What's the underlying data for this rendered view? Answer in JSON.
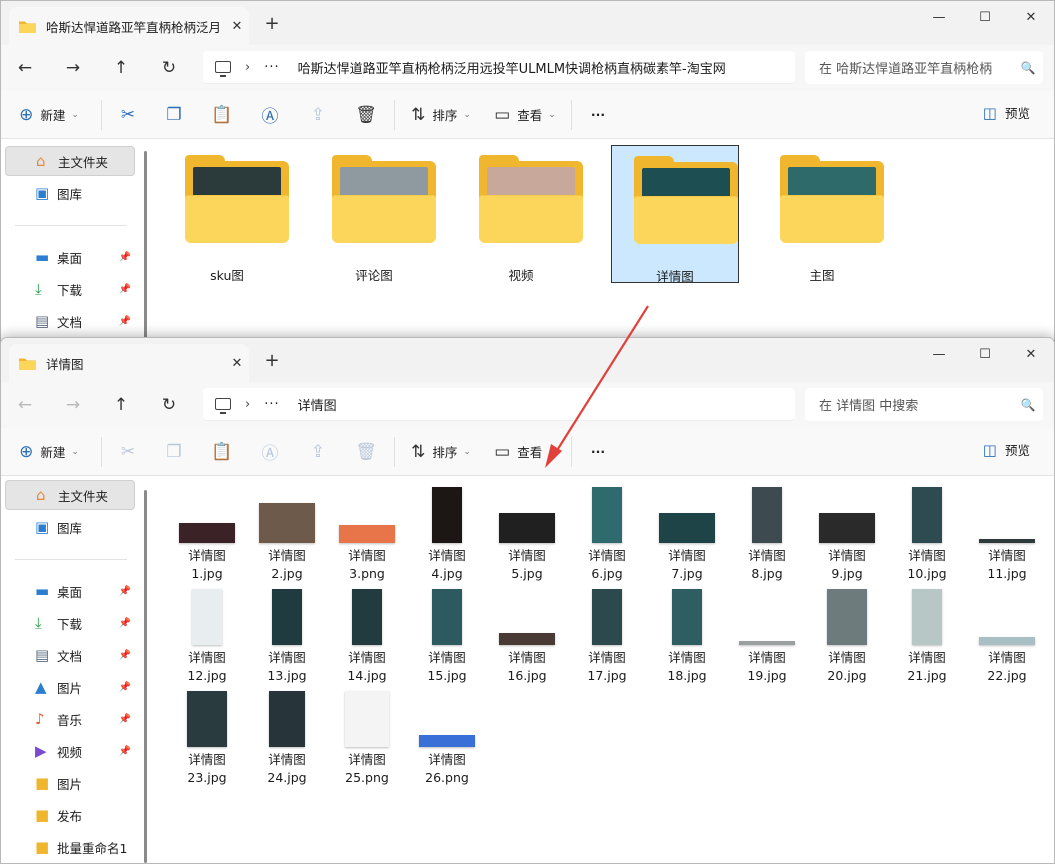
{
  "window_back": {
    "tab_title": "哈斯达悍道路亚竿直柄枪柄泛月",
    "address_path": "哈斯达悍道路亚竿直柄枪柄泛用远投竿ULMLM快调枪柄直柄碳素竿-淘宝网",
    "search_placeholder": "在 哈斯达悍道路亚竿直柄枪柄",
    "folders": [
      {
        "name": "sku图",
        "thumb_color": "#2b3a3a"
      },
      {
        "name": "评论图",
        "thumb_color": "#8e9aa0"
      },
      {
        "name": "视频",
        "thumb_color": "#c8a89a"
      },
      {
        "name": "详情图",
        "thumb_color": "#1d4f52"
      },
      {
        "name": "主图",
        "thumb_color": "#2e6a6a"
      }
    ],
    "sidebar": [
      {
        "label": "主文件夹",
        "icon": "home-icon"
      },
      {
        "label": "图库",
        "icon": "gallery-icon"
      },
      {
        "label": "桌面",
        "icon": "desktop-icon"
      },
      {
        "label": "下载",
        "icon": "download-icon"
      },
      {
        "label": "文档",
        "icon": "document-icon"
      }
    ]
  },
  "window_front": {
    "tab_title": "详情图",
    "address_path": "详情图",
    "search_placeholder": "在 详情图 中搜索",
    "sidebar": [
      {
        "label": "主文件夹",
        "icon": "home-icon"
      },
      {
        "label": "图库",
        "icon": "gallery-icon"
      },
      {
        "label": "桌面",
        "icon": "desktop-icon"
      },
      {
        "label": "下载",
        "icon": "download-icon"
      },
      {
        "label": "文档",
        "icon": "document-icon"
      },
      {
        "label": "图片",
        "icon": "pictures-icon"
      },
      {
        "label": "音乐",
        "icon": "music-icon"
      },
      {
        "label": "视频",
        "icon": "video-icon"
      },
      {
        "label": "图片",
        "icon": "folder-icon"
      },
      {
        "label": "发布",
        "icon": "folder-icon"
      },
      {
        "label": "批量重命名1",
        "icon": "folder-icon"
      }
    ],
    "files": [
      {
        "l1": "详情图",
        "l2": "1.jpg",
        "c": "#3a2226"
      },
      {
        "l1": "详情图",
        "l2": "2.jpg",
        "c": "#6d5a4a"
      },
      {
        "l1": "详情图",
        "l2": "3.png",
        "c": "#e8744a"
      },
      {
        "l1": "详情图",
        "l2": "4.jpg",
        "c": "#1c1714"
      },
      {
        "l1": "详情图",
        "l2": "5.jpg",
        "c": "#202020"
      },
      {
        "l1": "详情图",
        "l2": "6.jpg",
        "c": "#2f6a6e"
      },
      {
        "l1": "详情图",
        "l2": "7.jpg",
        "c": "#1e4448"
      },
      {
        "l1": "详情图",
        "l2": "8.jpg",
        "c": "#3d4b50"
      },
      {
        "l1": "详情图",
        "l2": "9.jpg",
        "c": "#2a2a2a"
      },
      {
        "l1": "详情图",
        "l2": "10.jpg",
        "c": "#2d4b50"
      },
      {
        "l1": "详情图",
        "l2": "11.jpg",
        "c": "#2f3a3a"
      },
      {
        "l1": "详情图",
        "l2": "12.jpg",
        "c": "#e8eef0"
      },
      {
        "l1": "详情图",
        "l2": "13.jpg",
        "c": "#1f3b40"
      },
      {
        "l1": "详情图",
        "l2": "14.jpg",
        "c": "#223b3f"
      },
      {
        "l1": "详情图",
        "l2": "15.jpg",
        "c": "#2d5a60"
      },
      {
        "l1": "详情图",
        "l2": "16.jpg",
        "c": "#4a3a36"
      },
      {
        "l1": "详情图",
        "l2": "17.jpg",
        "c": "#2c4a4e"
      },
      {
        "l1": "详情图",
        "l2": "18.jpg",
        "c": "#2f5e62"
      },
      {
        "l1": "详情图",
        "l2": "19.jpg",
        "c": "#9aa0a0"
      },
      {
        "l1": "详情图",
        "l2": "20.jpg",
        "c": "#6e7b7d"
      },
      {
        "l1": "详情图",
        "l2": "21.jpg",
        "c": "#b7c7c6"
      },
      {
        "l1": "详情图",
        "l2": "22.jpg",
        "c": "#a8c0c4"
      },
      {
        "l1": "详情图",
        "l2": "23.jpg",
        "c": "#2a3b40"
      },
      {
        "l1": "详情图",
        "l2": "24.jpg",
        "c": "#27353a"
      },
      {
        "l1": "详情图",
        "l2": "25.png",
        "c": "#f4f4f4"
      },
      {
        "l1": "详情图",
        "l2": "26.png",
        "c": "#3a6fd8"
      }
    ]
  },
  "toolbar": {
    "new": "新建",
    "sort": "排序",
    "view": "查看",
    "more": "···",
    "preview": "预览"
  },
  "colors": {
    "accent": "#2c6fb6",
    "selection": "#cce8ff",
    "folder": "#f0b62e",
    "arrow": "#e0413a"
  }
}
